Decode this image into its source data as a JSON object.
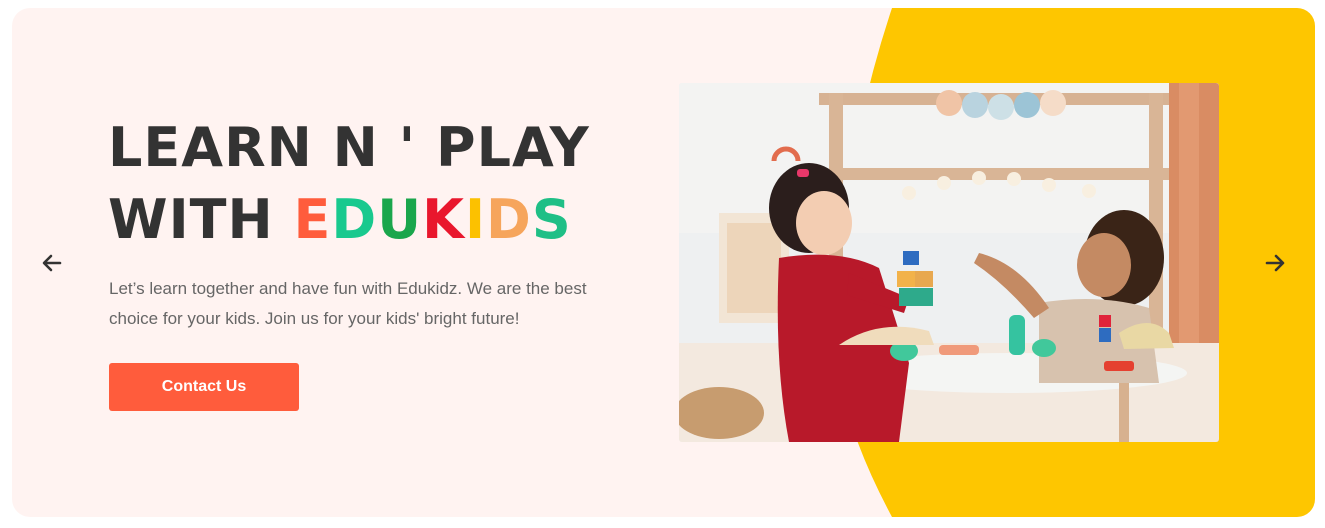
{
  "hero": {
    "title_line1": "LEARN N ' PLAY",
    "title_line2_prefix": "WITH",
    "brand_letters": [
      {
        "char": "E",
        "color": "#ff5c3c"
      },
      {
        "char": "D",
        "color": "#19c98e"
      },
      {
        "char": "U",
        "color": "#1aa64c"
      },
      {
        "char": "K",
        "color": "#e9172d"
      },
      {
        "char": "I",
        "color": "#fcc100"
      },
      {
        "char": "D",
        "color": "#f6a55c"
      },
      {
        "char": "S",
        "color": "#1fbf86"
      }
    ],
    "description": "Let’s learn together and have fun with Edukidz. We are the best choice for your kids. Join us for your kids' bright future!",
    "cta_label": "Contact Us",
    "prev_icon": "arrow-left-icon",
    "next_icon": "arrow-right-icon"
  },
  "colors": {
    "background": "#fff3f1",
    "accent_yellow": "#fec600",
    "cta": "#ff5c3c",
    "title": "#333333",
    "text": "#666666"
  }
}
